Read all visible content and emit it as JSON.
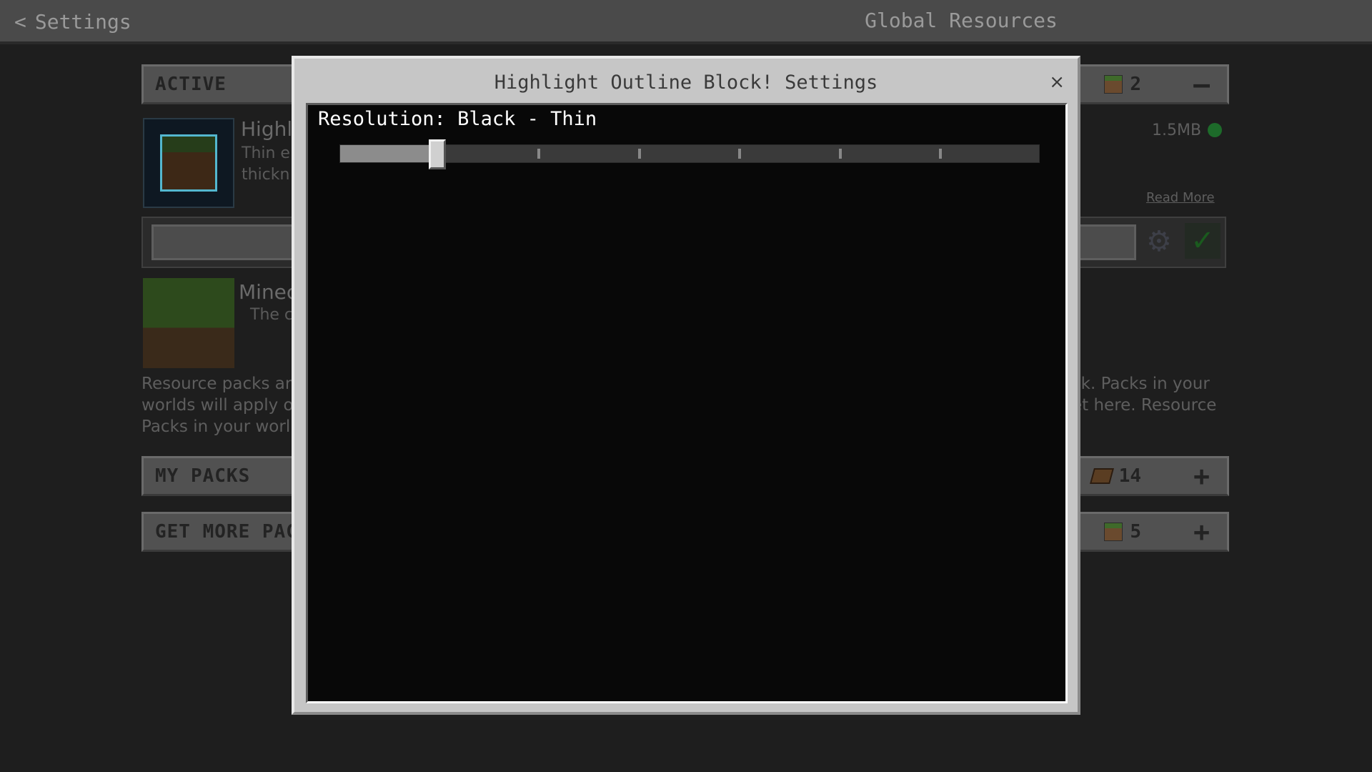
{
  "header": {
    "back_label": "Settings",
    "title": "Global Resources"
  },
  "sections": {
    "active": {
      "label": "ACTIVE",
      "count": "2",
      "action": "—"
    },
    "my_packs": {
      "label": "MY PACKS",
      "count": "14",
      "action": "+"
    },
    "get_more": {
      "label": "GET MORE PAC",
      "count": "5",
      "action": "+"
    }
  },
  "packs": [
    {
      "title": "Highl",
      "desc_line1": "Thin e",
      "desc_line2": "thickn",
      "size": "1.5MB",
      "read_more": "Read More"
    },
    {
      "title": "Minec",
      "desc": "The c"
    }
  ],
  "info_left": "Resource packs are\nworlds will apply o\nPacks in your worl",
  "info_right": "ck. Packs in your\net here. Resource",
  "modal": {
    "title": "Highlight Outline Block! Settings",
    "close_label": "×",
    "setting": {
      "label": "Resolution: Black - Thin",
      "slider_steps": 7,
      "slider_index": 1
    }
  },
  "icons": {
    "gear": "gear-icon",
    "check": "check-icon",
    "back": "chevron-left-icon",
    "close": "close-icon"
  },
  "colors": {
    "accent_check": "#1a5a1e",
    "status_on": "#1d6b2a",
    "modal_bg": "#c6c6c6",
    "modal_body": "#080808"
  }
}
